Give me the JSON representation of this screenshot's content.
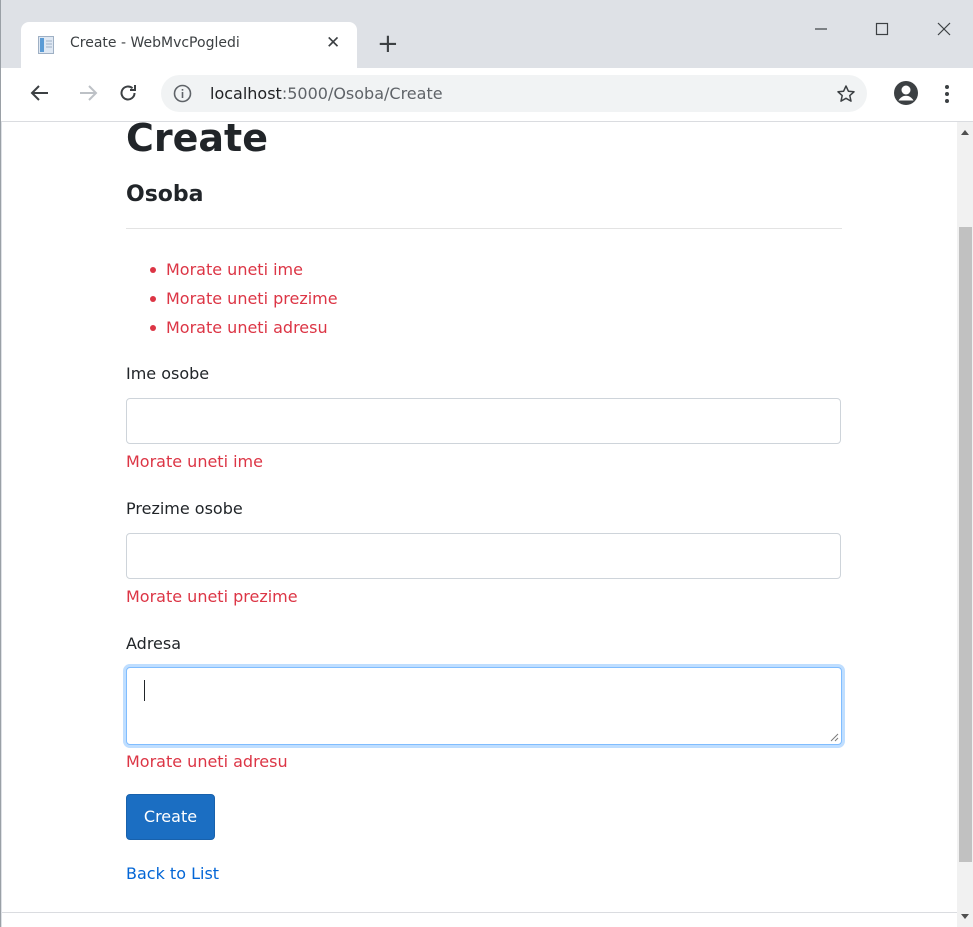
{
  "browser": {
    "tab_title": "Create - WebMvcPogledi",
    "url_host": "localhost",
    "url_rest": ":5000/Osoba/Create",
    "icons": [
      "page-favicon-icon",
      "close-icon",
      "plus-icon",
      "minimize-icon",
      "maximize-icon",
      "window-close-icon",
      "back-arrow-icon",
      "forward-arrow-icon",
      "reload-icon",
      "info-icon",
      "star-icon",
      "profile-icon",
      "kebab-menu-icon"
    ]
  },
  "page": {
    "title": "Create",
    "subtitle": "Osoba",
    "validation_summary": [
      "Morate uneti ime",
      "Morate uneti prezime",
      "Morate uneti adresu"
    ],
    "fields": {
      "ime": {
        "label": "Ime osobe",
        "value": "",
        "error": "Morate uneti ime"
      },
      "prezime": {
        "label": "Prezime osobe",
        "value": "",
        "error": "Morate uneti prezime"
      },
      "adresa": {
        "label": "Adresa",
        "value": "",
        "error": "Morate uneti adresu"
      }
    },
    "submit_label": "Create",
    "back_link": "Back to List"
  },
  "colors": {
    "error": "#dc3545",
    "primary_button": "#1b6ec2",
    "link": "#0366d6",
    "focus_border": "#80bdff"
  }
}
